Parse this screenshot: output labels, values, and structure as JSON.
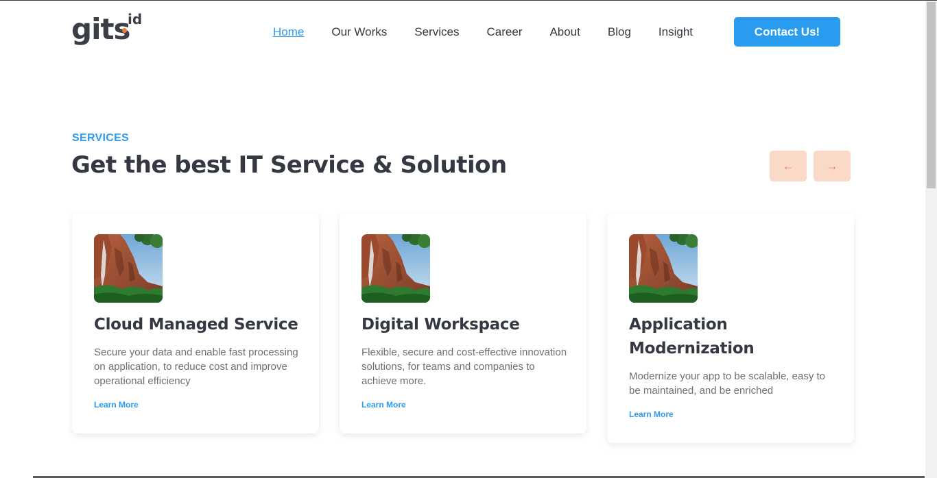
{
  "brand": {
    "logo_main": "gits",
    "logo_suffix": "id",
    "colors": {
      "primary": "#2a9cf0",
      "accent": "#f07b3f",
      "text": "#333842"
    }
  },
  "nav": {
    "items": [
      {
        "label": "Home",
        "active": true
      },
      {
        "label": "Our Works"
      },
      {
        "label": "Services"
      },
      {
        "label": "Career"
      },
      {
        "label": "About"
      },
      {
        "label": "Blog"
      },
      {
        "label": "Insight"
      }
    ],
    "cta_label": "Contact Us!"
  },
  "section": {
    "eyebrow": "SERVICES",
    "title": "Get the best IT Service & Solution",
    "prev_icon": "←",
    "next_icon": "→"
  },
  "cards": [
    {
      "title": "Cloud Managed Service",
      "description": "Secure your data and enable fast processing on application, to reduce cost and improve operational efficiency",
      "link_label": "Learn More"
    },
    {
      "title": "Digital Workspace",
      "description": "Flexible, secure and cost-effective innovation solutions, for teams and companies to achieve more.",
      "link_label": "Learn More"
    },
    {
      "title": "Application Modernization",
      "description": "Modernize your app to be scalable, easy to be maintained, and be enriched",
      "link_label": "Learn More"
    }
  ]
}
